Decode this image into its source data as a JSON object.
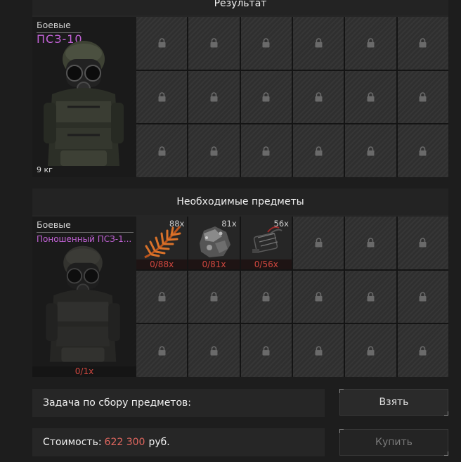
{
  "result_section": {
    "title": "Результат",
    "item": {
      "category": "Боевые",
      "name": "ПСЗ-10",
      "weight": "9 кг"
    }
  },
  "required_section": {
    "title": "Необходимые предметы",
    "main_item": {
      "category": "Боевые",
      "name": "Поношенный ПСЗ-1...",
      "requirement": "0/1x"
    },
    "materials": [
      {
        "icon": "fern-leaf-icon",
        "quantity": "88x",
        "requirement": "0/88x"
      },
      {
        "icon": "ore-rock-icon",
        "quantity": "81x",
        "requirement": "0/81x"
      },
      {
        "icon": "circuit-part-icon",
        "quantity": "56x",
        "requirement": "0/56x"
      }
    ]
  },
  "task_bar": {
    "label": "Задача по сбору предметов:"
  },
  "cost_bar": {
    "label": "Стоимость:",
    "value": "622 300",
    "currency": "руб."
  },
  "buttons": {
    "take": "Взять",
    "buy": "Купить"
  },
  "colors": {
    "rarity_purple": "#c262d6",
    "requirement_red": "#d0473f",
    "cost_red": "#e0675f"
  }
}
